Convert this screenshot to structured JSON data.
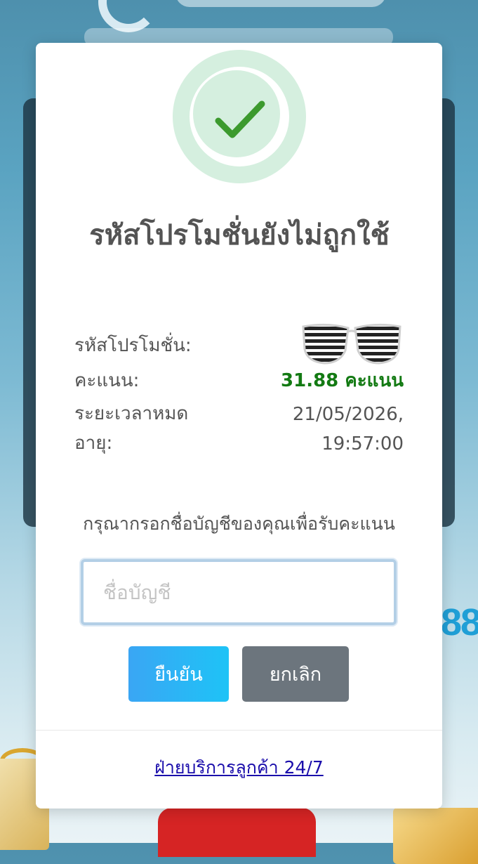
{
  "modal": {
    "title": "รหัสโปรโมชั่นยังไม่ถูกใช้",
    "status_icon": "success-check-icon",
    "success_color": "#3c9a2e",
    "info": {
      "promo_code_label": "รหัสโปรโมชั่น:",
      "promo_code_image": "striped-shutter-glasses-image",
      "points_label": "คะแนน:",
      "points_value": "31.88 คะแนน",
      "expiry_label": "ระยะเวลาหมดอายุ:",
      "expiry_date": "21/05/2026,",
      "expiry_time": "19:57:00"
    },
    "prompt": "กรุณากรอกชื่อบัญชีของคุณเพื่อรับคะแนน",
    "account_input": {
      "placeholder": "ชื่อบัญชี",
      "value": ""
    },
    "buttons": {
      "confirm_label": "ยืนยัน",
      "cancel_label": "ยกเลิก"
    },
    "support_link": "ฝ่ายบริการลูกค้า 24/7"
  },
  "colors": {
    "points_green": "#137a13",
    "confirm_button": "#27b3f5",
    "cancel_button": "#6c757d",
    "link_blue": "#1a0dab"
  }
}
